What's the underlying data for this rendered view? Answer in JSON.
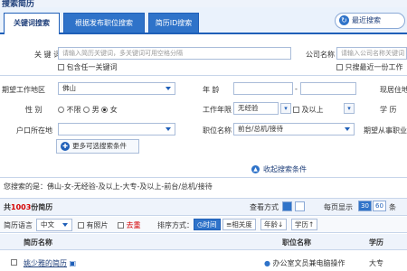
{
  "page": {
    "title": "搜索简历"
  },
  "tabs": [
    {
      "label": "关键词搜索"
    },
    {
      "label": "根据发布职位搜索"
    },
    {
      "label": "简历ID搜索"
    }
  ],
  "recent_search": {
    "label": "最近搜索"
  },
  "keyword": {
    "label": "关 键 词",
    "placeholder": "请输入简历关键词，多关键词可用空格分隔",
    "any_word": "包含任一关键词"
  },
  "company": {
    "label": "公司名称",
    "placeholder": "请输入公司名称关键词",
    "recent_only": "只搜最近一份工作"
  },
  "location": {
    "label": "期望工作地区",
    "value": "佛山"
  },
  "age": {
    "label": "年 龄",
    "sep": "-"
  },
  "current_location": {
    "label": "现居住地"
  },
  "gender": {
    "label": "性 别",
    "options": [
      "不限",
      "男",
      "女"
    ],
    "selected": "女"
  },
  "experience": {
    "label": "工作年限",
    "value": "无经验",
    "range": "及以上"
  },
  "education": {
    "label": "学 历"
  },
  "hukou": {
    "label": "户口所在地"
  },
  "position": {
    "label": "职位名称",
    "value": "前台/总机/接待"
  },
  "desired_industry": {
    "label": "期望从事职业"
  },
  "more_conditions": {
    "label": "更多可选搜索条件"
  },
  "collapse": {
    "label": "收起搜索条件"
  },
  "criteria": {
    "text": "您搜索的是：佛山-女-无经验-及以上-大专-及以上-前台/总机/接待"
  },
  "results": {
    "prefix": "共",
    "count": "1003",
    "suffix": "份简历",
    "view_label": "查看方式",
    "per_page_label": "每页显示",
    "per_page_options": [
      "30",
      "60"
    ],
    "per_page_unit": "条"
  },
  "filter": {
    "lang_label": "简历语言",
    "lang_value": "中文",
    "photo_label": "有照片",
    "dedupe_label": "去重",
    "sort_label": "排序方式：",
    "sort_options": [
      "时间",
      "相关度",
      "年龄",
      "学历"
    ]
  },
  "table": {
    "headers": [
      "简历名称",
      "职位名称",
      "学历"
    ],
    "rows": [
      {
        "name": "姚少雅的简历",
        "position": "办公室文员兼电脑操作",
        "education": "大专"
      }
    ]
  },
  "colors": {
    "primary": "#2f73c9",
    "accent_red": "#d40000",
    "header_bg": "#eaf2fc"
  }
}
